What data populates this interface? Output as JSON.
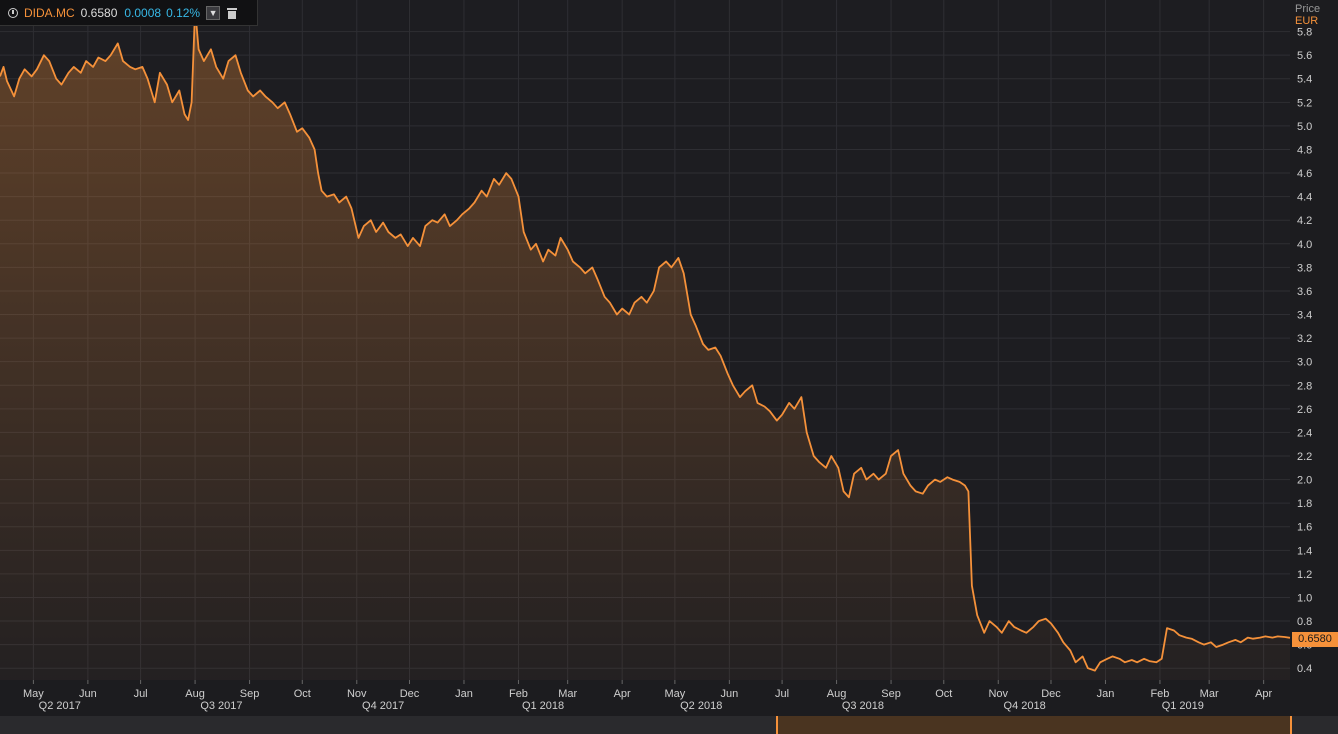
{
  "legend": {
    "symbol": "DIDA.MC",
    "last": "0.6580",
    "change": "0.0008",
    "change_pct": "0.12%"
  },
  "axis": {
    "unit": "Price",
    "currency": "EUR"
  },
  "last_price_label": "0.6580",
  "colors": {
    "line": "#f5913a",
    "background": "#1d1d21",
    "change": "#37b8e6",
    "grid": "#2e2e33"
  },
  "icons": [
    "clock-icon",
    "dropdown-icon",
    "trash-icon"
  ],
  "chart_data": {
    "type": "area",
    "x_start": "2017-04-12",
    "x_end": "2019-04-16",
    "ylim": [
      0.3,
      6.0
    ],
    "ytick_labels": [
      "0.4",
      "0.6",
      "0.8",
      "1.0",
      "1.2",
      "1.4",
      "1.6",
      "1.8",
      "2.0",
      "2.2",
      "2.4",
      "2.6",
      "2.8",
      "3.0",
      "3.2",
      "3.4",
      "3.6",
      "3.8",
      "4.0",
      "4.2",
      "4.4",
      "4.6",
      "4.8",
      "5.0",
      "5.2",
      "5.4",
      "5.6",
      "5.8"
    ],
    "months": [
      {
        "label": "May",
        "date": "2017-05-01"
      },
      {
        "label": "Jun",
        "date": "2017-06-01"
      },
      {
        "label": "Jul",
        "date": "2017-07-01"
      },
      {
        "label": "Aug",
        "date": "2017-08-01"
      },
      {
        "label": "Sep",
        "date": "2017-09-01"
      },
      {
        "label": "Oct",
        "date": "2017-10-01"
      },
      {
        "label": "Nov",
        "date": "2017-11-01"
      },
      {
        "label": "Dec",
        "date": "2017-12-01"
      },
      {
        "label": "Jan",
        "date": "2018-01-01"
      },
      {
        "label": "Feb",
        "date": "2018-02-01"
      },
      {
        "label": "Mar",
        "date": "2018-03-01"
      },
      {
        "label": "Apr",
        "date": "2018-04-01"
      },
      {
        "label": "May",
        "date": "2018-05-01"
      },
      {
        "label": "Jun",
        "date": "2018-06-01"
      },
      {
        "label": "Jul",
        "date": "2018-07-01"
      },
      {
        "label": "Aug",
        "date": "2018-08-01"
      },
      {
        "label": "Sep",
        "date": "2018-09-01"
      },
      {
        "label": "Oct",
        "date": "2018-10-01"
      },
      {
        "label": "Nov",
        "date": "2018-11-01"
      },
      {
        "label": "Dec",
        "date": "2018-12-01"
      },
      {
        "label": "Jan",
        "date": "2019-01-01"
      },
      {
        "label": "Feb",
        "date": "2019-02-01"
      },
      {
        "label": "Mar",
        "date": "2019-03-01"
      },
      {
        "label": "Apr",
        "date": "2019-04-01"
      }
    ],
    "quarters": [
      {
        "label": "Q2 2017",
        "date": "2017-05-16"
      },
      {
        "label": "Q3 2017",
        "date": "2017-08-16"
      },
      {
        "label": "Q4 2017",
        "date": "2017-11-16"
      },
      {
        "label": "Q1 2018",
        "date": "2018-02-15"
      },
      {
        "label": "Q2 2018",
        "date": "2018-05-16"
      },
      {
        "label": "Q3 2018",
        "date": "2018-08-16"
      },
      {
        "label": "Q4 2018",
        "date": "2018-11-16"
      },
      {
        "label": "Q1 2019",
        "date": "2019-02-14"
      }
    ],
    "series": [
      {
        "values": [
          [
            "2017-04-12",
            5.42
          ],
          [
            "2017-04-14",
            5.5
          ],
          [
            "2017-04-16",
            5.38
          ],
          [
            "2017-04-20",
            5.25
          ],
          [
            "2017-04-23",
            5.4
          ],
          [
            "2017-04-26",
            5.48
          ],
          [
            "2017-04-30",
            5.42
          ],
          [
            "2017-05-03",
            5.48
          ],
          [
            "2017-05-07",
            5.6
          ],
          [
            "2017-05-10",
            5.55
          ],
          [
            "2017-05-14",
            5.4
          ],
          [
            "2017-05-17",
            5.35
          ],
          [
            "2017-05-21",
            5.45
          ],
          [
            "2017-05-24",
            5.5
          ],
          [
            "2017-05-28",
            5.45
          ],
          [
            "2017-05-31",
            5.55
          ],
          [
            "2017-06-04",
            5.5
          ],
          [
            "2017-06-07",
            5.58
          ],
          [
            "2017-06-11",
            5.55
          ],
          [
            "2017-06-14",
            5.6
          ],
          [
            "2017-06-18",
            5.7
          ],
          [
            "2017-06-21",
            5.55
          ],
          [
            "2017-06-25",
            5.5
          ],
          [
            "2017-06-28",
            5.48
          ],
          [
            "2017-07-02",
            5.5
          ],
          [
            "2017-07-05",
            5.4
          ],
          [
            "2017-07-09",
            5.2
          ],
          [
            "2017-07-12",
            5.45
          ],
          [
            "2017-07-16",
            5.35
          ],
          [
            "2017-07-19",
            5.2
          ],
          [
            "2017-07-23",
            5.3
          ],
          [
            "2017-07-26",
            5.1
          ],
          [
            "2017-07-28",
            5.05
          ],
          [
            "2017-07-30",
            5.2
          ],
          [
            "2017-08-01",
            5.99
          ],
          [
            "2017-08-03",
            5.65
          ],
          [
            "2017-08-06",
            5.55
          ],
          [
            "2017-08-10",
            5.65
          ],
          [
            "2017-08-13",
            5.5
          ],
          [
            "2017-08-17",
            5.4
          ],
          [
            "2017-08-20",
            5.55
          ],
          [
            "2017-08-24",
            5.6
          ],
          [
            "2017-08-27",
            5.45
          ],
          [
            "2017-08-31",
            5.3
          ],
          [
            "2017-09-03",
            5.25
          ],
          [
            "2017-09-07",
            5.3
          ],
          [
            "2017-09-10",
            5.25
          ],
          [
            "2017-09-14",
            5.2
          ],
          [
            "2017-09-17",
            5.15
          ],
          [
            "2017-09-21",
            5.2
          ],
          [
            "2017-09-24",
            5.1
          ],
          [
            "2017-09-28",
            4.95
          ],
          [
            "2017-10-01",
            4.98
          ],
          [
            "2017-10-05",
            4.9
          ],
          [
            "2017-10-08",
            4.8
          ],
          [
            "2017-10-10",
            4.6
          ],
          [
            "2017-10-12",
            4.45
          ],
          [
            "2017-10-15",
            4.4
          ],
          [
            "2017-10-19",
            4.42
          ],
          [
            "2017-10-22",
            4.35
          ],
          [
            "2017-10-26",
            4.4
          ],
          [
            "2017-10-29",
            4.3
          ],
          [
            "2017-11-02",
            4.05
          ],
          [
            "2017-11-05",
            4.15
          ],
          [
            "2017-11-09",
            4.2
          ],
          [
            "2017-11-12",
            4.1
          ],
          [
            "2017-11-16",
            4.18
          ],
          [
            "2017-11-19",
            4.1
          ],
          [
            "2017-11-23",
            4.05
          ],
          [
            "2017-11-26",
            4.08
          ],
          [
            "2017-11-30",
            3.98
          ],
          [
            "2017-12-03",
            4.05
          ],
          [
            "2017-12-07",
            3.98
          ],
          [
            "2017-12-10",
            4.15
          ],
          [
            "2017-12-14",
            4.2
          ],
          [
            "2017-12-17",
            4.18
          ],
          [
            "2017-12-21",
            4.25
          ],
          [
            "2017-12-24",
            4.15
          ],
          [
            "2017-12-28",
            4.2
          ],
          [
            "2017-12-31",
            4.25
          ],
          [
            "2018-01-04",
            4.3
          ],
          [
            "2018-01-07",
            4.35
          ],
          [
            "2018-01-11",
            4.45
          ],
          [
            "2018-01-14",
            4.4
          ],
          [
            "2018-01-18",
            4.55
          ],
          [
            "2018-01-21",
            4.5
          ],
          [
            "2018-01-25",
            4.6
          ],
          [
            "2018-01-28",
            4.55
          ],
          [
            "2018-02-01",
            4.4
          ],
          [
            "2018-02-04",
            4.1
          ],
          [
            "2018-02-08",
            3.95
          ],
          [
            "2018-02-11",
            4.0
          ],
          [
            "2018-02-15",
            3.85
          ],
          [
            "2018-02-18",
            3.95
          ],
          [
            "2018-02-22",
            3.9
          ],
          [
            "2018-02-25",
            4.05
          ],
          [
            "2018-03-01",
            3.95
          ],
          [
            "2018-03-04",
            3.85
          ],
          [
            "2018-03-08",
            3.8
          ],
          [
            "2018-03-11",
            3.75
          ],
          [
            "2018-03-15",
            3.8
          ],
          [
            "2018-03-18",
            3.7
          ],
          [
            "2018-03-22",
            3.55
          ],
          [
            "2018-03-25",
            3.5
          ],
          [
            "2018-03-29",
            3.4
          ],
          [
            "2018-04-01",
            3.45
          ],
          [
            "2018-04-05",
            3.4
          ],
          [
            "2018-04-08",
            3.5
          ],
          [
            "2018-04-12",
            3.55
          ],
          [
            "2018-04-15",
            3.5
          ],
          [
            "2018-04-19",
            3.6
          ],
          [
            "2018-04-22",
            3.8
          ],
          [
            "2018-04-26",
            3.85
          ],
          [
            "2018-04-29",
            3.8
          ],
          [
            "2018-05-03",
            3.88
          ],
          [
            "2018-05-06",
            3.75
          ],
          [
            "2018-05-10",
            3.4
          ],
          [
            "2018-05-13",
            3.3
          ],
          [
            "2018-05-17",
            3.15
          ],
          [
            "2018-05-20",
            3.1
          ],
          [
            "2018-05-24",
            3.12
          ],
          [
            "2018-05-27",
            3.05
          ],
          [
            "2018-05-31",
            2.9
          ],
          [
            "2018-06-03",
            2.8
          ],
          [
            "2018-06-07",
            2.7
          ],
          [
            "2018-06-10",
            2.75
          ],
          [
            "2018-06-14",
            2.8
          ],
          [
            "2018-06-17",
            2.65
          ],
          [
            "2018-06-21",
            2.62
          ],
          [
            "2018-06-24",
            2.58
          ],
          [
            "2018-06-28",
            2.5
          ],
          [
            "2018-07-01",
            2.55
          ],
          [
            "2018-07-05",
            2.65
          ],
          [
            "2018-07-08",
            2.6
          ],
          [
            "2018-07-12",
            2.7
          ],
          [
            "2018-07-15",
            2.4
          ],
          [
            "2018-07-19",
            2.2
          ],
          [
            "2018-07-22",
            2.15
          ],
          [
            "2018-07-26",
            2.1
          ],
          [
            "2018-07-29",
            2.2
          ],
          [
            "2018-08-02",
            2.1
          ],
          [
            "2018-08-05",
            1.9
          ],
          [
            "2018-08-08",
            1.85
          ],
          [
            "2018-08-11",
            2.05
          ],
          [
            "2018-08-15",
            2.1
          ],
          [
            "2018-08-18",
            2.0
          ],
          [
            "2018-08-22",
            2.05
          ],
          [
            "2018-08-25",
            2.0
          ],
          [
            "2018-08-29",
            2.05
          ],
          [
            "2018-09-01",
            2.2
          ],
          [
            "2018-09-05",
            2.25
          ],
          [
            "2018-09-08",
            2.05
          ],
          [
            "2018-09-12",
            1.95
          ],
          [
            "2018-09-15",
            1.9
          ],
          [
            "2018-09-19",
            1.88
          ],
          [
            "2018-09-22",
            1.95
          ],
          [
            "2018-09-26",
            2.0
          ],
          [
            "2018-09-29",
            1.98
          ],
          [
            "2018-10-03",
            2.02
          ],
          [
            "2018-10-06",
            2.0
          ],
          [
            "2018-10-10",
            1.98
          ],
          [
            "2018-10-13",
            1.95
          ],
          [
            "2018-10-15",
            1.9
          ],
          [
            "2018-10-17",
            1.1
          ],
          [
            "2018-10-20",
            0.85
          ],
          [
            "2018-10-24",
            0.7
          ],
          [
            "2018-10-27",
            0.8
          ],
          [
            "2018-10-31",
            0.75
          ],
          [
            "2018-11-03",
            0.7
          ],
          [
            "2018-11-07",
            0.8
          ],
          [
            "2018-11-10",
            0.75
          ],
          [
            "2018-11-14",
            0.72
          ],
          [
            "2018-11-17",
            0.7
          ],
          [
            "2018-11-21",
            0.75
          ],
          [
            "2018-11-24",
            0.8
          ],
          [
            "2018-11-28",
            0.82
          ],
          [
            "2018-12-01",
            0.78
          ],
          [
            "2018-12-05",
            0.7
          ],
          [
            "2018-12-08",
            0.62
          ],
          [
            "2018-12-12",
            0.55
          ],
          [
            "2018-12-15",
            0.45
          ],
          [
            "2018-12-19",
            0.5
          ],
          [
            "2018-12-22",
            0.4
          ],
          [
            "2018-12-26",
            0.38
          ],
          [
            "2018-12-29",
            0.45
          ],
          [
            "2019-01-02",
            0.48
          ],
          [
            "2019-01-05",
            0.5
          ],
          [
            "2019-01-09",
            0.48
          ],
          [
            "2019-01-12",
            0.45
          ],
          [
            "2019-01-16",
            0.47
          ],
          [
            "2019-01-19",
            0.45
          ],
          [
            "2019-01-23",
            0.48
          ],
          [
            "2019-01-26",
            0.46
          ],
          [
            "2019-01-30",
            0.45
          ],
          [
            "2019-02-02",
            0.48
          ],
          [
            "2019-02-05",
            0.74
          ],
          [
            "2019-02-09",
            0.72
          ],
          [
            "2019-02-12",
            0.68
          ],
          [
            "2019-02-16",
            0.66
          ],
          [
            "2019-02-19",
            0.65
          ],
          [
            "2019-02-23",
            0.62
          ],
          [
            "2019-02-26",
            0.6
          ],
          [
            "2019-03-02",
            0.62
          ],
          [
            "2019-03-05",
            0.58
          ],
          [
            "2019-03-09",
            0.6
          ],
          [
            "2019-03-12",
            0.62
          ],
          [
            "2019-03-16",
            0.64
          ],
          [
            "2019-03-19",
            0.62
          ],
          [
            "2019-03-23",
            0.66
          ],
          [
            "2019-03-26",
            0.65
          ],
          [
            "2019-03-30",
            0.66
          ],
          [
            "2019-04-02",
            0.67
          ],
          [
            "2019-04-06",
            0.66
          ],
          [
            "2019-04-09",
            0.67
          ],
          [
            "2019-04-13",
            0.665
          ],
          [
            "2019-04-16",
            0.658
          ]
        ]
      }
    ]
  }
}
